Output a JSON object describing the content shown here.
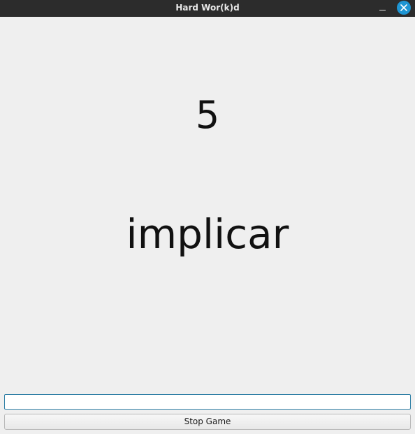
{
  "window": {
    "title": "Hard Wor(k)d"
  },
  "titlebar": {
    "minimize_icon": "minimize-icon",
    "close_icon": "close-icon",
    "close_color": "#1e95d3"
  },
  "game": {
    "counter": "5",
    "word": "implicar"
  },
  "answer": {
    "value": ""
  },
  "controls": {
    "stop_label": "Stop Game"
  }
}
